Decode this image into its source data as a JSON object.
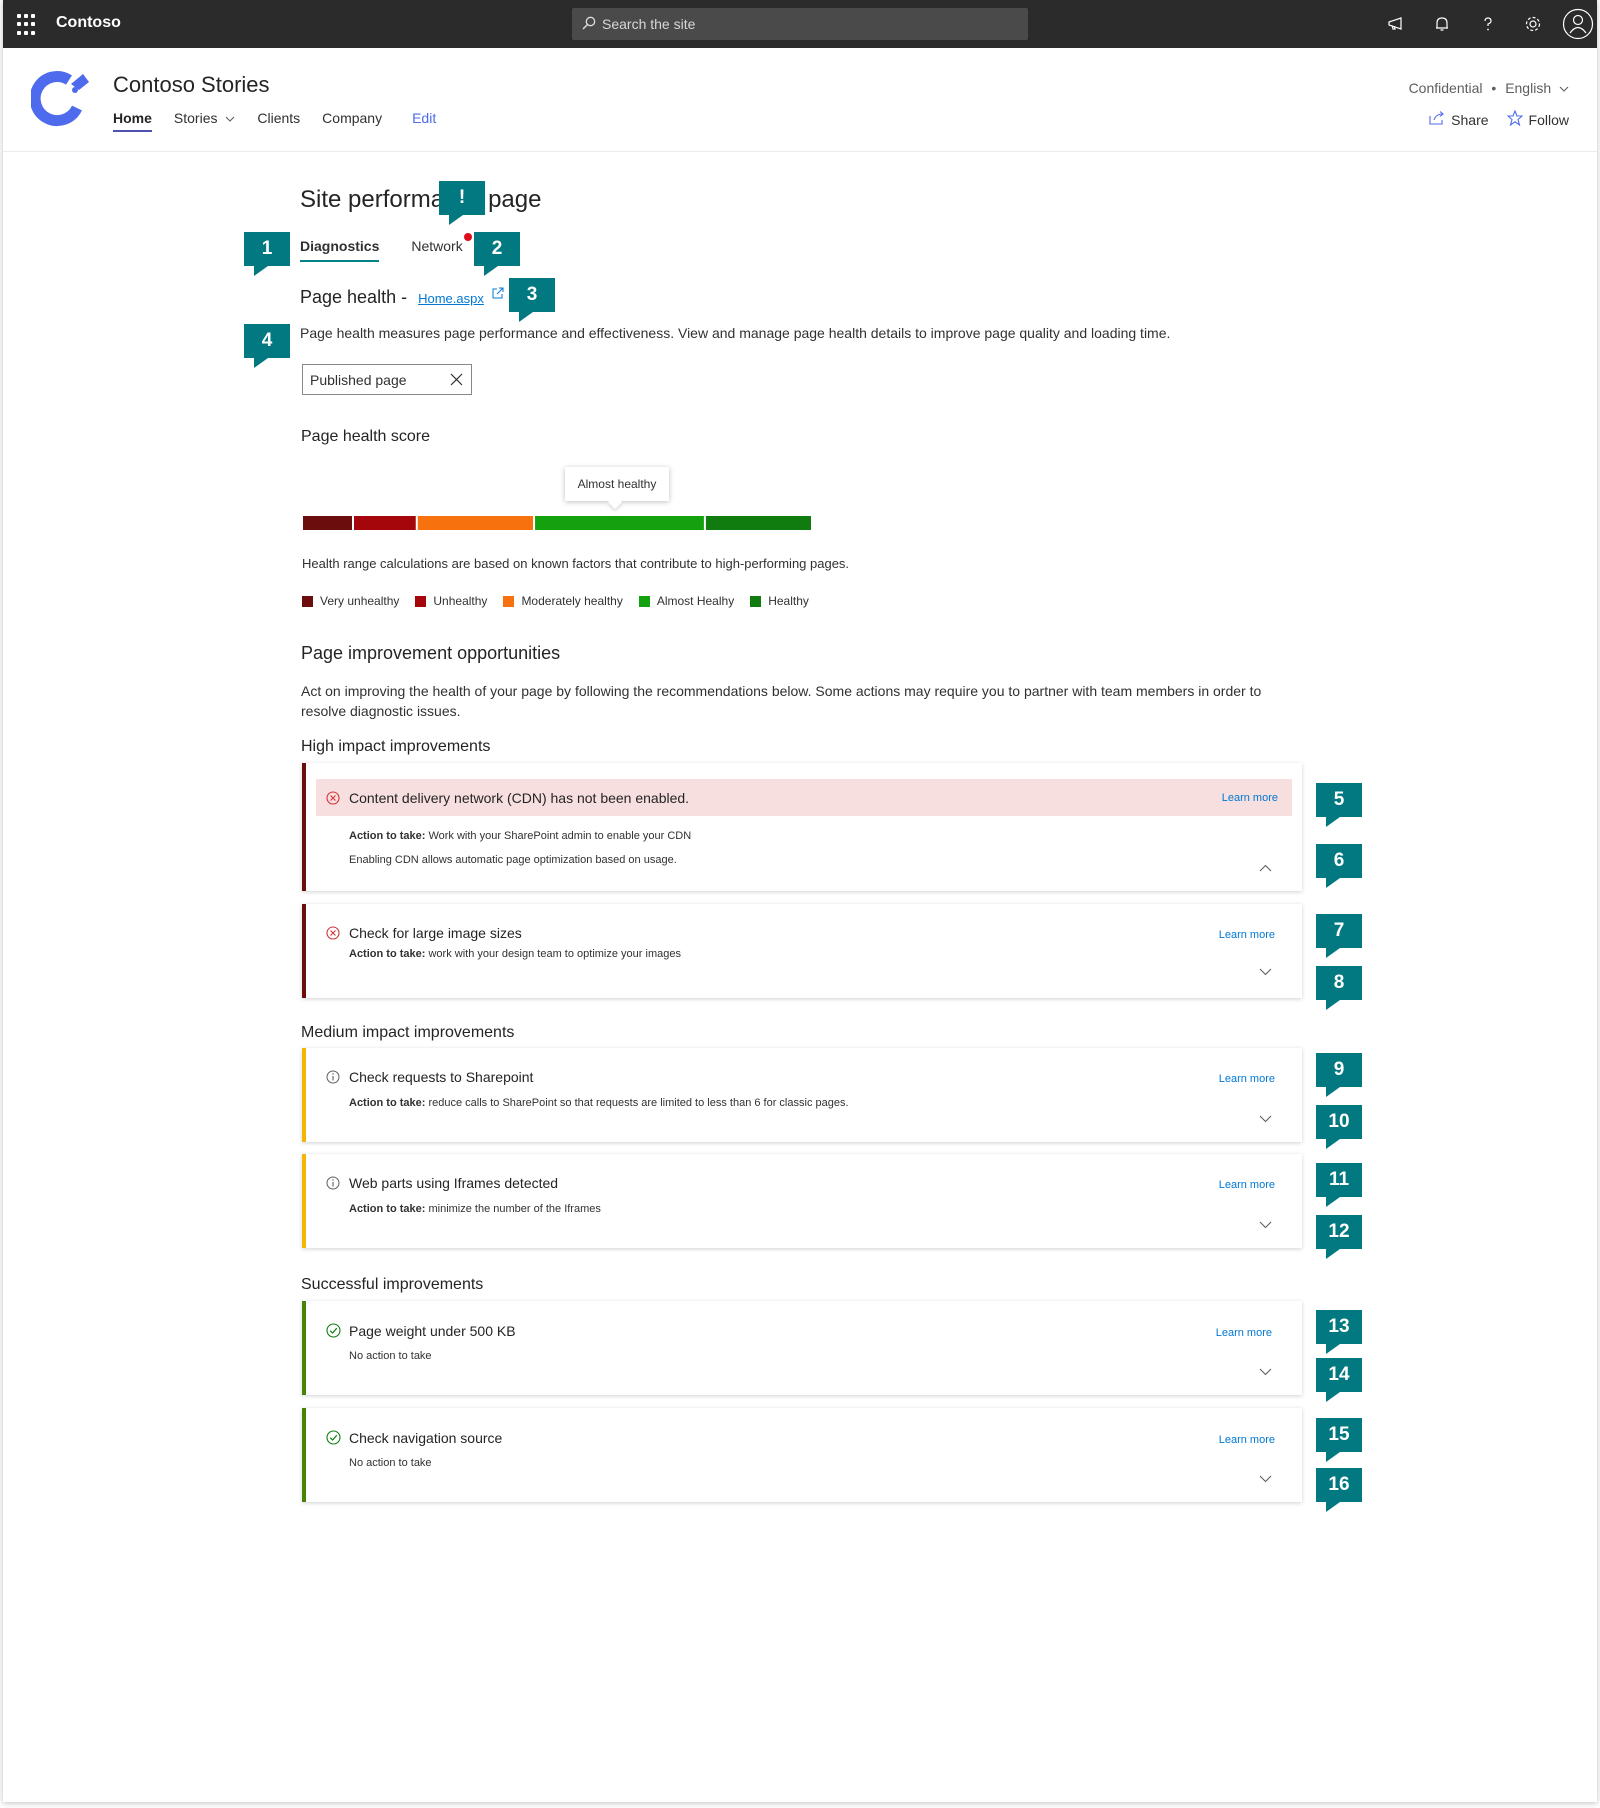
{
  "suite": {
    "brand": "Contoso",
    "search_placeholder": "Search the site"
  },
  "site": {
    "title": "Contoso Stories",
    "nav": [
      "Home",
      "Stories",
      "Clients",
      "Company"
    ],
    "edit_label": "Edit",
    "confidential": "Confidential",
    "separator": "•",
    "language": "English",
    "share_label": "Share",
    "follow_label": "Follow"
  },
  "page": {
    "title_before": "Site performa",
    "title_after": "page",
    "tabs": [
      "Diagnostics",
      "Network"
    ],
    "page_health_label": "Page health -",
    "page_link": "Home.aspx",
    "page_health_desc": "Page health measures page performance and effectiveness. View and manage page health details to improve page quality and loading time.",
    "filter_value": "Published page"
  },
  "score": {
    "title": "Page health score",
    "tooltip": "Almost healthy",
    "range_note": "Health range calculations are based on known factors that contribute to high-performing pages.",
    "level_fraction": 0.62,
    "segments": [
      {
        "name": "Very unhealthy",
        "color": "#6b0d0d",
        "fraction": 0.1
      },
      {
        "name": "Unhealthy",
        "color": "#a4060c",
        "fraction": 0.125
      },
      {
        "name": "Moderately healthy",
        "color": "#f7720e",
        "fraction": 0.23
      },
      {
        "name": "Almost Healhy",
        "color": "#13a10e",
        "fraction": 0.335
      },
      {
        "name": "Healthy",
        "color": "#107c10",
        "fraction": 0.21
      }
    ],
    "legend": [
      "Very unhealthy",
      "Unhealthy",
      "Moderately healthy",
      "Almost Healhy",
      "Healthy"
    ]
  },
  "improvements": {
    "title": "Page improvement opportunities",
    "desc": "Act on improving the health of your page by following the recommendations below. Some actions may require you to partner with team members in order to resolve diagnostic issues.",
    "action_label": "Action to take:",
    "learn_more": "Learn more",
    "high": {
      "title": "High impact improvements",
      "items": [
        {
          "title": "Content delivery network  (CDN) has not been enabled.",
          "action": "Work with your SharePoint admin to enable your CDN",
          "detail": "Enabling CDN allows automatic page optimization based on usage."
        },
        {
          "title": "Check for large image sizes",
          "action": "work with your design team to optimize your images"
        }
      ]
    },
    "medium": {
      "title": "Medium impact improvements",
      "items": [
        {
          "title": "Check requests to Sharepoint",
          "action": "reduce calls to SharePoint so that requests are limited to less than 6 for classic pages."
        },
        {
          "title": "Web parts using Iframes detected",
          "action": "minimize the number of the Iframes"
        }
      ]
    },
    "success": {
      "title": "Successful improvements",
      "items": [
        {
          "title": "Page weight under 500 KB",
          "action": "No action to take"
        },
        {
          "title": "Check navigation source",
          "action": "No action to take"
        }
      ]
    }
  },
  "callouts": [
    "!",
    "1",
    "2",
    "3",
    "4",
    "5",
    "6",
    "7",
    "8",
    "9",
    "10",
    "11",
    "12",
    "13",
    "14",
    "15",
    "16"
  ],
  "colors": {
    "callout": "#027881",
    "accent": "#4f52b2",
    "link": "#0078d4",
    "error": "#d13438",
    "success": "#107c10"
  }
}
